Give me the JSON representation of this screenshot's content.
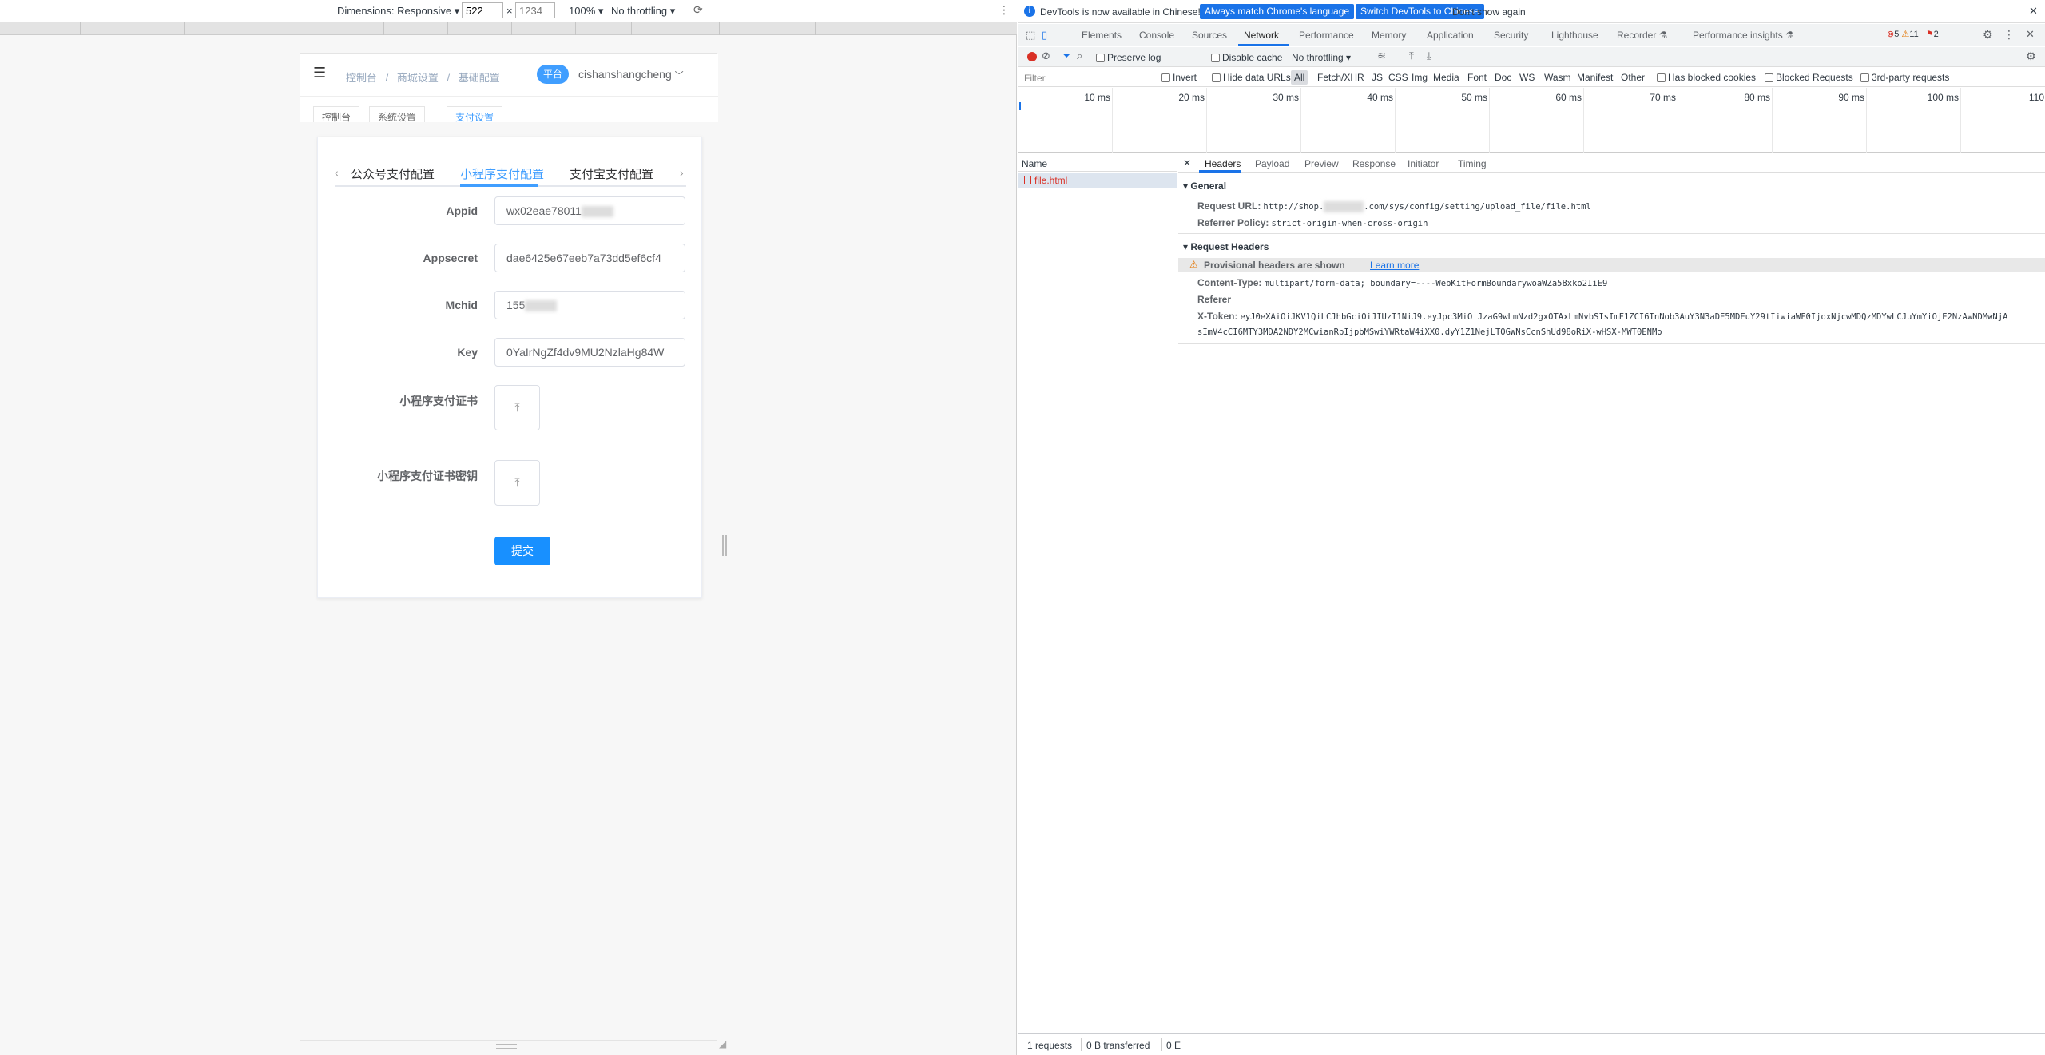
{
  "device_toolbar": {
    "dimensions_label": "Dimensions: Responsive",
    "width_value": "522",
    "height_placeholder": "1234",
    "zoom": "100%",
    "throttling": "No throttling"
  },
  "app": {
    "breadcrumb": [
      "控制台",
      "商城设置",
      "基础配置"
    ],
    "platform_badge": "平台",
    "username": "cishanshangcheng",
    "tag_tabs": [
      "控制台",
      "系统设置",
      "支付设置"
    ],
    "tabs": [
      "公众号支付配置",
      "小程序支付配置",
      "支付宝支付配置"
    ],
    "active_tab": 1,
    "form": {
      "appid_label": "Appid",
      "appid_value": "wx02eae78011",
      "appsecret_label": "Appsecret",
      "appsecret_value": "dae6425e67eeb7a73dd5ef6cf4",
      "mchid_label": "Mchid",
      "mchid_value": "155",
      "key_label": "Key",
      "key_value": "0YaIrNgZf4dv9MU2NzlaHg84W",
      "cert_label": "小程序支付证书",
      "cert_key_label": "小程序支付证书密钥",
      "submit_label": "提交"
    }
  },
  "devtools": {
    "infobar": {
      "message": "DevTools is now available in Chinese!",
      "btn_match": "Always match Chrome's language",
      "btn_switch": "Switch DevTools to Chinese",
      "dont_show": "Don't show again"
    },
    "panels": [
      "Elements",
      "Console",
      "Sources",
      "Network",
      "Performance",
      "Memory",
      "Application",
      "Security",
      "Lighthouse",
      "Recorder",
      "Performance insights"
    ],
    "active_panel": "Network",
    "counts": {
      "errors": "5",
      "warnings": "11",
      "issues": "2"
    },
    "toolbar": {
      "preserve_log": "Preserve log",
      "disable_cache": "Disable cache",
      "throttling": "No throttling"
    },
    "filter": {
      "placeholder": "Filter",
      "invert": "Invert",
      "hide_data_urls": "Hide data URLs",
      "types": [
        "All",
        "Fetch/XHR",
        "JS",
        "CSS",
        "Img",
        "Media",
        "Font",
        "Doc",
        "WS",
        "Wasm",
        "Manifest",
        "Other"
      ],
      "has_blocked_cookies": "Has blocked cookies",
      "blocked_requests": "Blocked Requests",
      "third_party": "3rd-party requests"
    },
    "timeline_ticks": [
      "10 ms",
      "20 ms",
      "30 ms",
      "40 ms",
      "50 ms",
      "60 ms",
      "70 ms",
      "80 ms",
      "90 ms",
      "100 ms",
      "110"
    ],
    "name_header": "Name",
    "request_name": "file.html",
    "detail_tabs": [
      "Headers",
      "Payload",
      "Preview",
      "Response",
      "Initiator",
      "Timing"
    ],
    "general": {
      "title": "General",
      "request_url_key": "Request URL:",
      "request_url_prefix": "http://shop.",
      "request_url_suffix": ".com/sys/config/setting/upload_file/file.html",
      "referrer_policy_key": "Referrer Policy:",
      "referrer_policy_value": "strict-origin-when-cross-origin"
    },
    "request_headers": {
      "title": "Request Headers",
      "provisional": "Provisional headers are shown",
      "learn_more": "Learn more",
      "content_type_key": "Content-Type:",
      "content_type_value": "multipart/form-data; boundary=----WebKitFormBoundarywoaWZa58xko2IiE9",
      "referer_key": "Referer",
      "x_token_key": "X-Token:",
      "x_token_value_1": "eyJ0eXAiOiJKV1QiLCJhbGciOiJIUzI1NiJ9.eyJpc3MiOiJzaG9wLmNzd2gxOTAxLmNvbSIsImF1ZCI6InNob3AuY3N3aDE5MDEuY29tIiwiaWF0IjoxNjcwMDQzMDYwLCJuYmYiOjE2NzAwNDMwNjA",
      "x_token_value_2": "sImV4cCI6MTY3MDA2NDY2MCwianRpIjpbMSwiYWRtaW4iXX0.dyY1Z1NejLTOGWNsCcnShUd98oRiX-wHSX-MWT0ENMo"
    },
    "status": {
      "requests": "1 requests",
      "transferred": "0 B transferred",
      "resources": "0 E"
    }
  }
}
